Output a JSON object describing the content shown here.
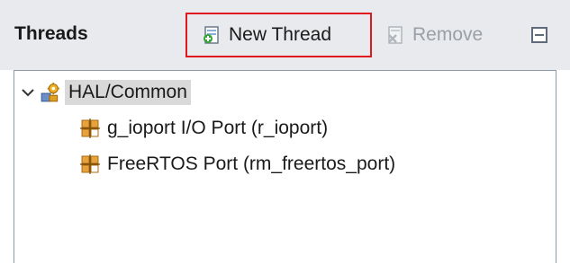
{
  "header": {
    "title": "Threads",
    "new_thread_label": "New Thread",
    "remove_label": "Remove"
  },
  "tree": {
    "root": {
      "label": "HAL/Common"
    },
    "children": [
      {
        "label": "g_ioport I/O Port (r_ioport)"
      },
      {
        "label": "FreeRTOS Port (rm_freertos_port)"
      }
    ]
  },
  "colors": {
    "highlight_border": "#e0191f",
    "header_bg": "#e8eaed",
    "selected_bg": "#d9d9d9"
  }
}
